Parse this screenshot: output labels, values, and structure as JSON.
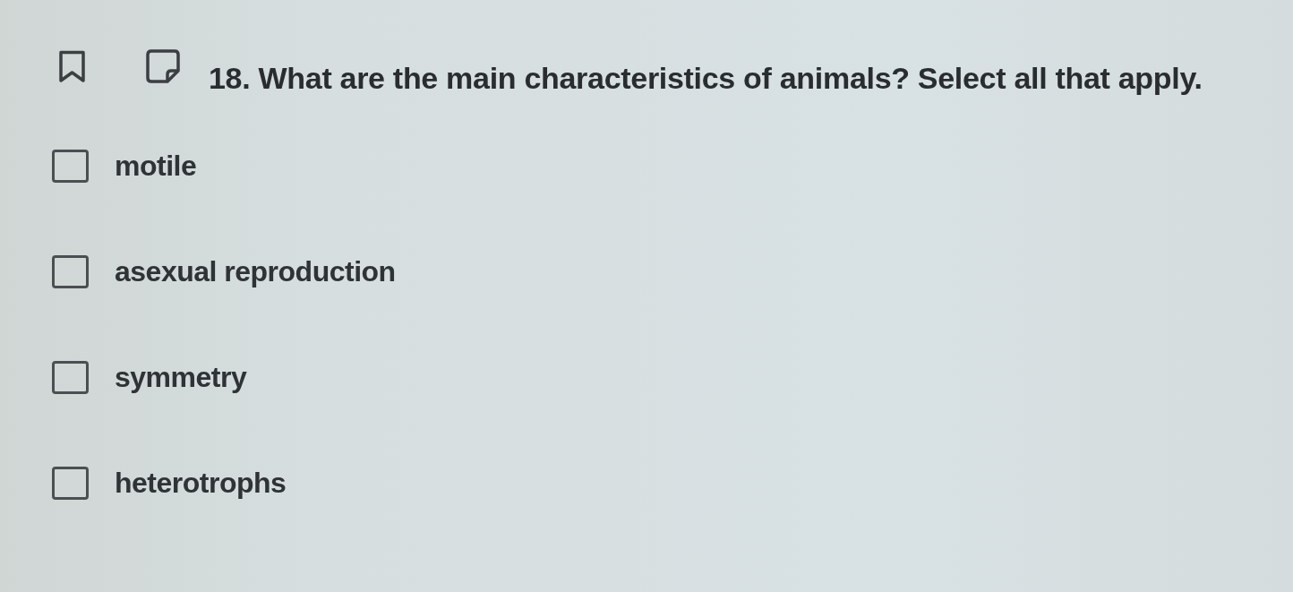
{
  "question": {
    "number": "18.",
    "text": "What are the main characteristics of animals? Select all that apply."
  },
  "options": [
    {
      "label": "motile",
      "checked": false
    },
    {
      "label": "asexual reproduction",
      "checked": false
    },
    {
      "label": "symmetry",
      "checked": false
    },
    {
      "label": "heterotrophs",
      "checked": false
    }
  ]
}
